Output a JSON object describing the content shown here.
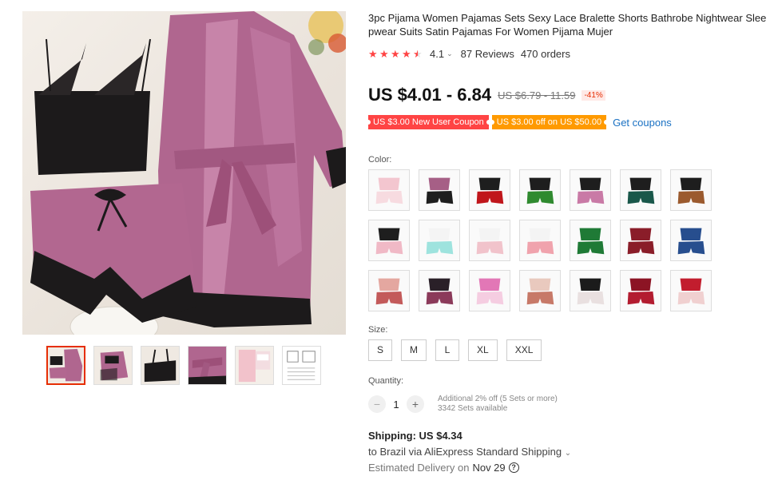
{
  "product": {
    "title": "3pc Pijama Women Pajamas Sets Sexy Lace Bralette Shorts Bathrobe Nightwear Sleepwear Suits Satin Pajamas For Women Pijama Mujer",
    "rating": "4.1",
    "reviews": "87 Reviews",
    "orders": "470 orders"
  },
  "price": {
    "current": "US $4.01 - 6.84",
    "original": "US $6.79 - 11.59",
    "discount": "-41%"
  },
  "coupons": {
    "new_user": "US $3.00 New User Coupon",
    "off": "US $3.00 off on US $50.00",
    "get_link": "Get coupons"
  },
  "color": {
    "label": "Color:",
    "swatches": [
      {
        "name": "swatch-1",
        "c1": "#f3c6cf",
        "c2": "#f7dbe0"
      },
      {
        "name": "swatch-2",
        "c1": "#a65f86",
        "c2": "#1e1e1e"
      },
      {
        "name": "swatch-3",
        "c1": "#1e1e1e",
        "c2": "#c0161b"
      },
      {
        "name": "swatch-4",
        "c1": "#1e1e1e",
        "c2": "#2f8a2f"
      },
      {
        "name": "swatch-5",
        "c1": "#1e1e1e",
        "c2": "#c97aa6"
      },
      {
        "name": "swatch-6",
        "c1": "#1e1e1e",
        "c2": "#19574a"
      },
      {
        "name": "swatch-7",
        "c1": "#1e1e1e",
        "c2": "#9b5a2e"
      },
      {
        "name": "swatch-8",
        "c1": "#1e1e1e",
        "c2": "#f0b9c6"
      },
      {
        "name": "swatch-9",
        "c1": "#f4f4f4",
        "c2": "#9ee3de"
      },
      {
        "name": "swatch-10",
        "c1": "#f4f4f4",
        "c2": "#f1c3cb"
      },
      {
        "name": "swatch-11",
        "c1": "#f4f4f4",
        "c2": "#f0a3ad"
      },
      {
        "name": "swatch-12",
        "c1": "#1f7a36",
        "c2": "#1f7a36"
      },
      {
        "name": "swatch-13",
        "c1": "#8a1d29",
        "c2": "#8a1d29"
      },
      {
        "name": "swatch-14",
        "c1": "#274e8e",
        "c2": "#274e8e"
      },
      {
        "name": "swatch-15",
        "c1": "#e4a7a0",
        "c2": "#c35a5a"
      },
      {
        "name": "swatch-16",
        "c1": "#2a2028",
        "c2": "#8b3a5a"
      },
      {
        "name": "swatch-17",
        "c1": "#e277b6",
        "c2": "#f5cde1"
      },
      {
        "name": "swatch-18",
        "c1": "#e9c9be",
        "c2": "#c77968"
      },
      {
        "name": "swatch-19",
        "c1": "#1b1b1b",
        "c2": "#e9e0e0"
      },
      {
        "name": "swatch-20",
        "c1": "#8c1424",
        "c2": "#b31c30"
      },
      {
        "name": "swatch-21",
        "c1": "#c21d2e",
        "c2": "#f0d0d0"
      }
    ]
  },
  "size": {
    "label": "Size:",
    "options": [
      "S",
      "M",
      "L",
      "XL",
      "XXL"
    ]
  },
  "quantity": {
    "label": "Quantity:",
    "minus": "−",
    "value": "1",
    "plus": "+",
    "note_line1": "Additional 2% off (5 Sets or more)",
    "note_line2": "3342 Sets available"
  },
  "shipping": {
    "title": "Shipping: US $4.34",
    "line": "to Brazil via AliExpress Standard Shipping",
    "delivery_label": "Estimated Delivery on",
    "delivery_date": "Nov 29",
    "help": "?"
  },
  "colors": {
    "accent": "#f44444",
    "link": "#1a71c3",
    "coupon_orange": "#ff9a00"
  }
}
